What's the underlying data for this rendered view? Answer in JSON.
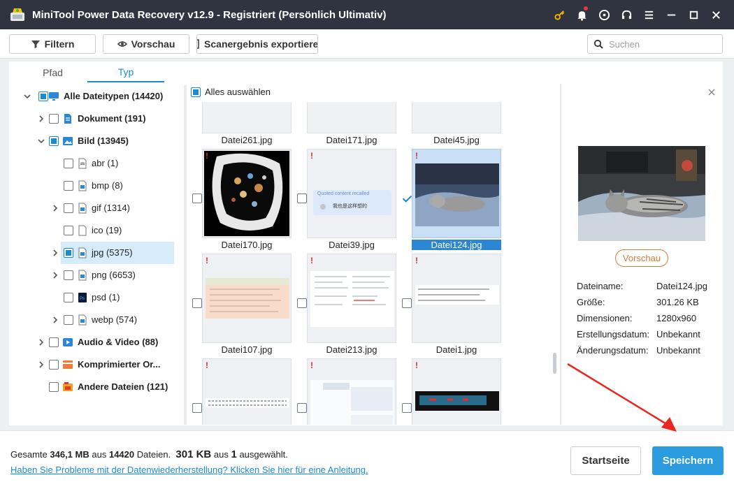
{
  "app": {
    "title": "MiniTool Power Data Recovery v12.9 - Registriert (Persönlich Ultimativ)",
    "title_icons": [
      "key-icon",
      "bell-icon",
      "disc-icon",
      "headset-icon",
      "menu-icon",
      "minimize-icon",
      "maximize-icon",
      "close-icon"
    ]
  },
  "toolbar": {
    "filter_label": "Filtern",
    "preview_label": "Vorschau",
    "export_label": "Scanergebnis exportieren",
    "search_placeholder": "Suchen"
  },
  "tabs": {
    "path": "Pfad",
    "type": "Typ"
  },
  "tree": [
    {
      "label": "Alle Dateitypen (14420)",
      "state": "partial",
      "expanded": true,
      "bold": true,
      "level": 0,
      "icon": "monitor-icon"
    },
    {
      "label": "Dokument (191)",
      "state": "unchecked",
      "expanded": false,
      "bold": true,
      "level": 1,
      "icon": "document-icon"
    },
    {
      "label": "Bild (13945)",
      "state": "partial",
      "expanded": true,
      "bold": true,
      "level": 1,
      "icon": "image-icon"
    },
    {
      "label": "abr (1)",
      "state": "unchecked",
      "level": 2,
      "icon": "abr-file-icon"
    },
    {
      "label": "bmp (8)",
      "state": "unchecked",
      "level": 2,
      "icon": "image-file-icon"
    },
    {
      "label": "gif (1314)",
      "state": "unchecked",
      "expandable": true,
      "level": 2,
      "icon": "image-file-icon"
    },
    {
      "label": "ico (19)",
      "state": "unchecked",
      "level": 2,
      "icon": "blank-file-icon"
    },
    {
      "label": "jpg (5375)",
      "state": "partial",
      "expandable": true,
      "selected": true,
      "level": 2,
      "icon": "image-file-icon"
    },
    {
      "label": "png (6653)",
      "state": "unchecked",
      "expandable": true,
      "level": 2,
      "icon": "image-file-icon"
    },
    {
      "label": "psd (1)",
      "state": "unchecked",
      "level": 2,
      "icon": "psd-file-icon"
    },
    {
      "label": "webp (574)",
      "state": "unchecked",
      "expandable": true,
      "level": 2,
      "icon": "image-file-icon"
    },
    {
      "label": "Audio & Video (88)",
      "state": "unchecked",
      "expandable": true,
      "bold": true,
      "level": 1,
      "icon": "video-icon"
    },
    {
      "label": "Komprimierter Or...",
      "state": "unchecked",
      "expandable": true,
      "bold": true,
      "level": 1,
      "icon": "archive-icon"
    },
    {
      "label": "Andere Dateien (121)",
      "state": "unchecked",
      "bold": true,
      "level": 1,
      "icon": "other-files-icon"
    }
  ],
  "grid": {
    "select_all_label": "Alles auswählen",
    "items": [
      {
        "name": "Datei261.jpg",
        "checked": false,
        "selected": false
      },
      {
        "name": "Datei171.jpg",
        "checked": false,
        "selected": false
      },
      {
        "name": "Datei45.jpg",
        "checked": false,
        "selected": false
      },
      {
        "name": "Datei170.jpg",
        "checked": false,
        "selected": false
      },
      {
        "name": "Datei39.jpg",
        "checked": false,
        "selected": false
      },
      {
        "name": "Datei124.jpg",
        "checked": true,
        "selected": true
      },
      {
        "name": "Datei107.jpg",
        "checked": false,
        "selected": false
      },
      {
        "name": "Datei213.jpg",
        "checked": false,
        "selected": false
      },
      {
        "name": "Datei1.jpg",
        "checked": false,
        "selected": false
      },
      {
        "name": "",
        "checked": false,
        "selected": false
      },
      {
        "name": "",
        "checked": false,
        "selected": false
      },
      {
        "name": "",
        "checked": false,
        "selected": false
      }
    ],
    "thumb_text": {
      "quoted": "Quoted content recalled",
      "chinese": "我也是这样想的"
    }
  },
  "preview": {
    "button_label": "Vorschau",
    "info": [
      {
        "key": "Dateiname:",
        "value": "Datei124.jpg"
      },
      {
        "key": "Größe:",
        "value": "301.26 KB"
      },
      {
        "key": "Dimensionen:",
        "value": "1280x960"
      },
      {
        "key": "Erstellungsdatum:",
        "value": "Unbekannt"
      },
      {
        "key": "Änderungsdatum:",
        "value": "Unbekannt"
      }
    ]
  },
  "footer": {
    "summary_prefix": "Gesamte",
    "total_size": "346,1 MB",
    "summary_mid": "aus",
    "total_files": "14420",
    "summary_files_word": "Dateien.",
    "selected_size": "301 KB",
    "selected_mid": "aus",
    "selected_count": "1",
    "selected_suffix": "ausgewählt.",
    "help_link": "Haben Sie Probleme mit der Datenwiederherstellung? Klicken Sie hier für eine Anleitung.",
    "home_label": "Startseite",
    "save_label": "Speichern"
  },
  "colors": {
    "titlebar": "#2f3440",
    "accent": "#1a8ad4",
    "save_button": "#2b9be0",
    "preview_button": "#e0793a",
    "annotation_arrow": "#e8281e"
  }
}
